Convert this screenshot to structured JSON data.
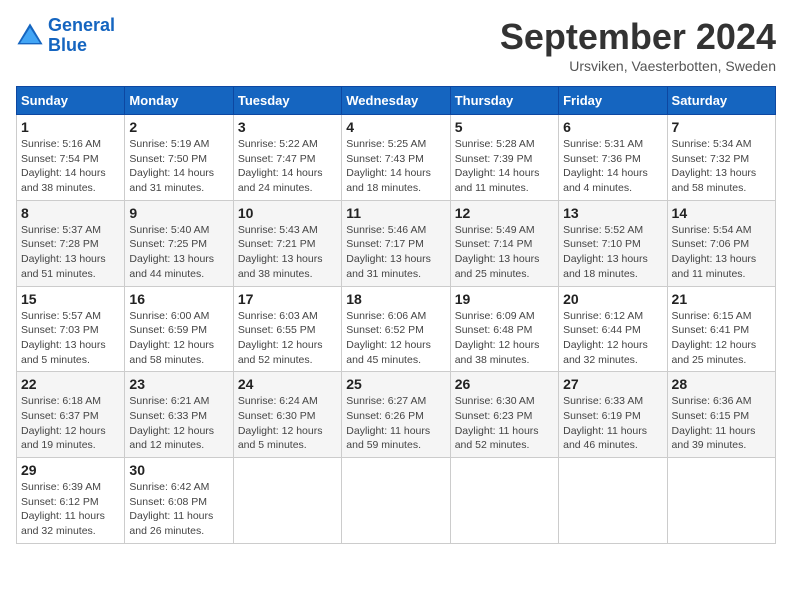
{
  "logo": {
    "line1": "General",
    "line2": "Blue"
  },
  "title": "September 2024",
  "subtitle": "Ursviken, Vaesterbotten, Sweden",
  "days_of_week": [
    "Sunday",
    "Monday",
    "Tuesday",
    "Wednesday",
    "Thursday",
    "Friday",
    "Saturday"
  ],
  "weeks": [
    [
      {
        "day": "1",
        "info": "Sunrise: 5:16 AM\nSunset: 7:54 PM\nDaylight: 14 hours\nand 38 minutes."
      },
      {
        "day": "2",
        "info": "Sunrise: 5:19 AM\nSunset: 7:50 PM\nDaylight: 14 hours\nand 31 minutes."
      },
      {
        "day": "3",
        "info": "Sunrise: 5:22 AM\nSunset: 7:47 PM\nDaylight: 14 hours\nand 24 minutes."
      },
      {
        "day": "4",
        "info": "Sunrise: 5:25 AM\nSunset: 7:43 PM\nDaylight: 14 hours\nand 18 minutes."
      },
      {
        "day": "5",
        "info": "Sunrise: 5:28 AM\nSunset: 7:39 PM\nDaylight: 14 hours\nand 11 minutes."
      },
      {
        "day": "6",
        "info": "Sunrise: 5:31 AM\nSunset: 7:36 PM\nDaylight: 14 hours\nand 4 minutes."
      },
      {
        "day": "7",
        "info": "Sunrise: 5:34 AM\nSunset: 7:32 PM\nDaylight: 13 hours\nand 58 minutes."
      }
    ],
    [
      {
        "day": "8",
        "info": "Sunrise: 5:37 AM\nSunset: 7:28 PM\nDaylight: 13 hours\nand 51 minutes."
      },
      {
        "day": "9",
        "info": "Sunrise: 5:40 AM\nSunset: 7:25 PM\nDaylight: 13 hours\nand 44 minutes."
      },
      {
        "day": "10",
        "info": "Sunrise: 5:43 AM\nSunset: 7:21 PM\nDaylight: 13 hours\nand 38 minutes."
      },
      {
        "day": "11",
        "info": "Sunrise: 5:46 AM\nSunset: 7:17 PM\nDaylight: 13 hours\nand 31 minutes."
      },
      {
        "day": "12",
        "info": "Sunrise: 5:49 AM\nSunset: 7:14 PM\nDaylight: 13 hours\nand 25 minutes."
      },
      {
        "day": "13",
        "info": "Sunrise: 5:52 AM\nSunset: 7:10 PM\nDaylight: 13 hours\nand 18 minutes."
      },
      {
        "day": "14",
        "info": "Sunrise: 5:54 AM\nSunset: 7:06 PM\nDaylight: 13 hours\nand 11 minutes."
      }
    ],
    [
      {
        "day": "15",
        "info": "Sunrise: 5:57 AM\nSunset: 7:03 PM\nDaylight: 13 hours\nand 5 minutes."
      },
      {
        "day": "16",
        "info": "Sunrise: 6:00 AM\nSunset: 6:59 PM\nDaylight: 12 hours\nand 58 minutes."
      },
      {
        "day": "17",
        "info": "Sunrise: 6:03 AM\nSunset: 6:55 PM\nDaylight: 12 hours\nand 52 minutes."
      },
      {
        "day": "18",
        "info": "Sunrise: 6:06 AM\nSunset: 6:52 PM\nDaylight: 12 hours\nand 45 minutes."
      },
      {
        "day": "19",
        "info": "Sunrise: 6:09 AM\nSunset: 6:48 PM\nDaylight: 12 hours\nand 38 minutes."
      },
      {
        "day": "20",
        "info": "Sunrise: 6:12 AM\nSunset: 6:44 PM\nDaylight: 12 hours\nand 32 minutes."
      },
      {
        "day": "21",
        "info": "Sunrise: 6:15 AM\nSunset: 6:41 PM\nDaylight: 12 hours\nand 25 minutes."
      }
    ],
    [
      {
        "day": "22",
        "info": "Sunrise: 6:18 AM\nSunset: 6:37 PM\nDaylight: 12 hours\nand 19 minutes."
      },
      {
        "day": "23",
        "info": "Sunrise: 6:21 AM\nSunset: 6:33 PM\nDaylight: 12 hours\nand 12 minutes."
      },
      {
        "day": "24",
        "info": "Sunrise: 6:24 AM\nSunset: 6:30 PM\nDaylight: 12 hours\nand 5 minutes."
      },
      {
        "day": "25",
        "info": "Sunrise: 6:27 AM\nSunset: 6:26 PM\nDaylight: 11 hours\nand 59 minutes."
      },
      {
        "day": "26",
        "info": "Sunrise: 6:30 AM\nSunset: 6:23 PM\nDaylight: 11 hours\nand 52 minutes."
      },
      {
        "day": "27",
        "info": "Sunrise: 6:33 AM\nSunset: 6:19 PM\nDaylight: 11 hours\nand 46 minutes."
      },
      {
        "day": "28",
        "info": "Sunrise: 6:36 AM\nSunset: 6:15 PM\nDaylight: 11 hours\nand 39 minutes."
      }
    ],
    [
      {
        "day": "29",
        "info": "Sunrise: 6:39 AM\nSunset: 6:12 PM\nDaylight: 11 hours\nand 32 minutes."
      },
      {
        "day": "30",
        "info": "Sunrise: 6:42 AM\nSunset: 6:08 PM\nDaylight: 11 hours\nand 26 minutes."
      },
      null,
      null,
      null,
      null,
      null
    ]
  ]
}
